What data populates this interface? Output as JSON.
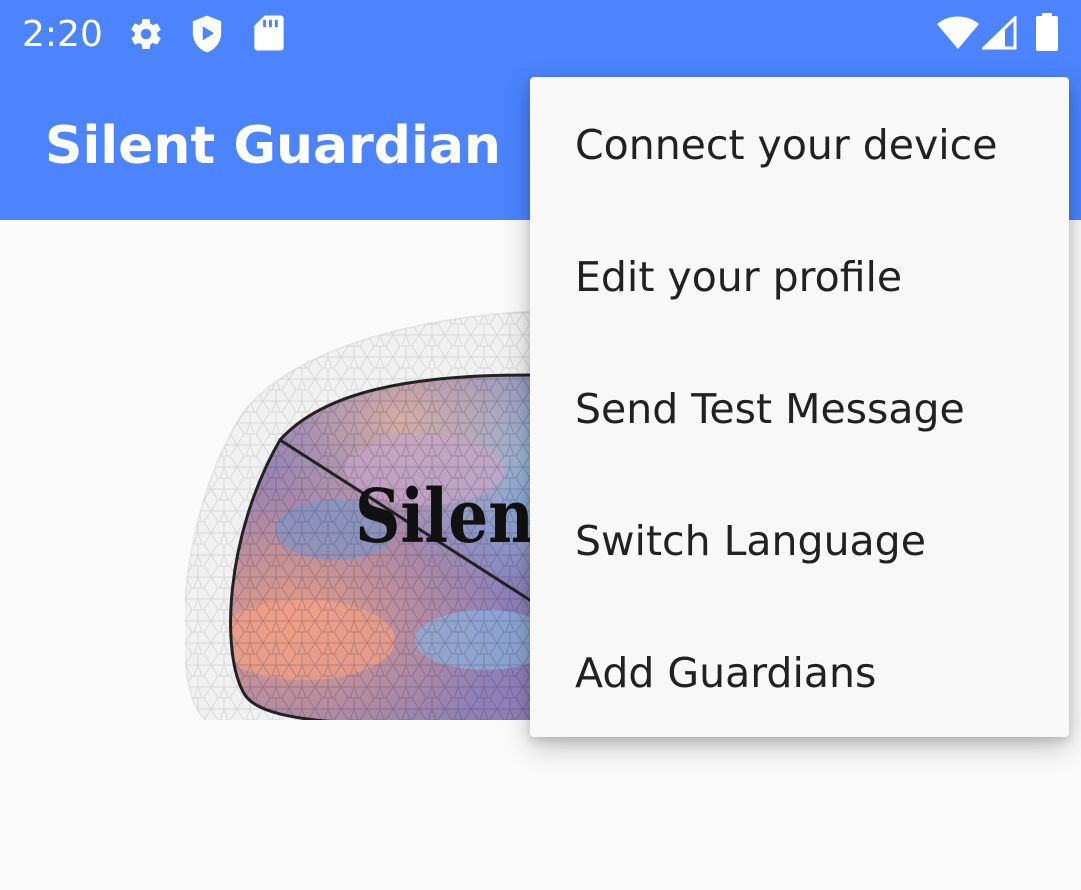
{
  "status_bar": {
    "time": "2:20",
    "color": "#4b84fe",
    "left_icons": [
      "gear-icon",
      "shield-play-icon",
      "sd-card-icon"
    ],
    "right_icons": [
      "wifi-icon",
      "cell-signal-icon",
      "battery-icon"
    ]
  },
  "app_bar": {
    "title": "Silent Guardian",
    "color": "#4b84fe"
  },
  "logo": {
    "text": "Silent G"
  },
  "menu": {
    "items": [
      {
        "label": "Connect your device"
      },
      {
        "label": "Edit your profile"
      },
      {
        "label": "Send Test Message"
      },
      {
        "label": "Switch Language"
      },
      {
        "label": "Add Guardians"
      }
    ]
  }
}
